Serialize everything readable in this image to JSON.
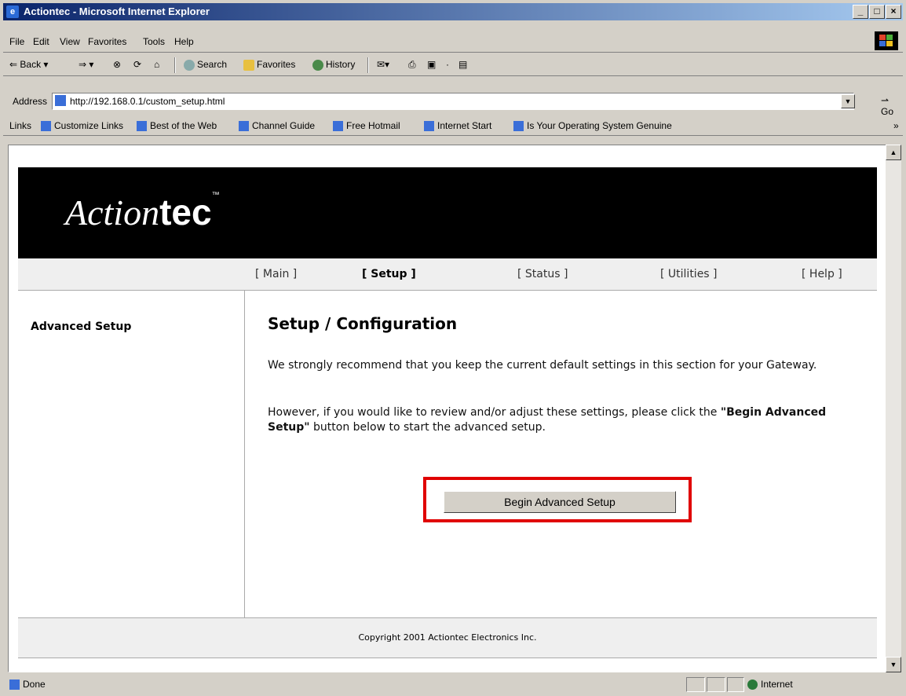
{
  "window": {
    "title": "Actiontec - Microsoft Internet Explorer"
  },
  "menubar": {
    "items": [
      "File",
      "Edit",
      "View",
      "Favorites",
      "Tools",
      "Help"
    ]
  },
  "toolbar": {
    "back": "Back",
    "search": "Search",
    "favorites": "Favorites",
    "history": "History"
  },
  "address": {
    "label": "Address",
    "url": "http://192.168.0.1/custom_setup.html",
    "go": "Go"
  },
  "links": {
    "label": "Links",
    "items": [
      "Customize Links",
      "Best of the Web",
      "Channel Guide",
      "Free Hotmail",
      "Internet Start",
      "Is Your Operating System Genuine"
    ]
  },
  "page": {
    "logo_script": "Action",
    "logo_bold": "tec",
    "logo_tm": "™",
    "nav": [
      "[ Main ]",
      "[ Setup ]",
      "[ Status ]",
      "[ Utilities ]",
      "[ Help ]"
    ],
    "side_title": "Advanced Setup",
    "heading": "Setup / Configuration",
    "para1": "We strongly recommend that you keep the current default settings in this section for your Gateway.",
    "para2_before": "However, if you would like to review and/or adjust these settings, please click the ",
    "para2_bold": "\"Begin Advanced Setup\"",
    "para2_after": " button below to start the advanced setup.",
    "button": "Begin Advanced Setup",
    "copyright": "Copyright 2001 Actiontec Electronics Inc.",
    "highlight_color": "#e00000"
  },
  "status": {
    "text": "Done",
    "zone": "Internet"
  }
}
